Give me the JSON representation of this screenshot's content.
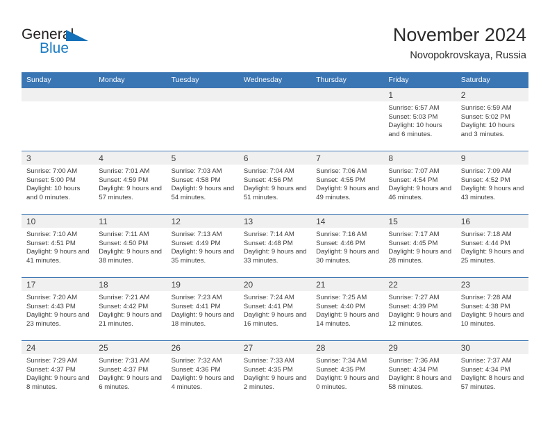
{
  "brand": {
    "name_top": "General",
    "name_bottom": "Blue",
    "triangle_color": "#1470b8",
    "text_color": "#231f20",
    "blue_color": "#1a7bc4"
  },
  "header": {
    "title": "November 2024",
    "subtitle": "Novopokrovskaya, Russia"
  },
  "theme": {
    "header_bg": "#3b76b4",
    "header_text": "#ffffff",
    "daynum_bg": "#f0f0f0",
    "row_separator": "#3b76b4",
    "body_text": "#3d3d3d"
  },
  "weekday_headers": [
    "Sunday",
    "Monday",
    "Tuesday",
    "Wednesday",
    "Thursday",
    "Friday",
    "Saturday"
  ],
  "labels": {
    "sunrise_prefix": "Sunrise:",
    "sunset_prefix": "Sunset:",
    "daylight_prefix": "Daylight:"
  },
  "weeks": [
    [
      {
        "day": "",
        "empty": true,
        "sunrise": "",
        "sunset": "",
        "daylight": ""
      },
      {
        "day": "",
        "empty": true,
        "sunrise": "",
        "sunset": "",
        "daylight": ""
      },
      {
        "day": "",
        "empty": true,
        "sunrise": "",
        "sunset": "",
        "daylight": ""
      },
      {
        "day": "",
        "empty": true,
        "sunrise": "",
        "sunset": "",
        "daylight": ""
      },
      {
        "day": "",
        "empty": true,
        "sunrise": "",
        "sunset": "",
        "daylight": ""
      },
      {
        "day": "1",
        "empty": false,
        "sunrise": "Sunrise: 6:57 AM",
        "sunset": "Sunset: 5:03 PM",
        "daylight": "Daylight: 10 hours and 6 minutes."
      },
      {
        "day": "2",
        "empty": false,
        "sunrise": "Sunrise: 6:59 AM",
        "sunset": "Sunset: 5:02 PM",
        "daylight": "Daylight: 10 hours and 3 minutes."
      }
    ],
    [
      {
        "day": "3",
        "empty": false,
        "sunrise": "Sunrise: 7:00 AM",
        "sunset": "Sunset: 5:00 PM",
        "daylight": "Daylight: 10 hours and 0 minutes."
      },
      {
        "day": "4",
        "empty": false,
        "sunrise": "Sunrise: 7:01 AM",
        "sunset": "Sunset: 4:59 PM",
        "daylight": "Daylight: 9 hours and 57 minutes."
      },
      {
        "day": "5",
        "empty": false,
        "sunrise": "Sunrise: 7:03 AM",
        "sunset": "Sunset: 4:58 PM",
        "daylight": "Daylight: 9 hours and 54 minutes."
      },
      {
        "day": "6",
        "empty": false,
        "sunrise": "Sunrise: 7:04 AM",
        "sunset": "Sunset: 4:56 PM",
        "daylight": "Daylight: 9 hours and 51 minutes."
      },
      {
        "day": "7",
        "empty": false,
        "sunrise": "Sunrise: 7:06 AM",
        "sunset": "Sunset: 4:55 PM",
        "daylight": "Daylight: 9 hours and 49 minutes."
      },
      {
        "day": "8",
        "empty": false,
        "sunrise": "Sunrise: 7:07 AM",
        "sunset": "Sunset: 4:54 PM",
        "daylight": "Daylight: 9 hours and 46 minutes."
      },
      {
        "day": "9",
        "empty": false,
        "sunrise": "Sunrise: 7:09 AM",
        "sunset": "Sunset: 4:52 PM",
        "daylight": "Daylight: 9 hours and 43 minutes."
      }
    ],
    [
      {
        "day": "10",
        "empty": false,
        "sunrise": "Sunrise: 7:10 AM",
        "sunset": "Sunset: 4:51 PM",
        "daylight": "Daylight: 9 hours and 41 minutes."
      },
      {
        "day": "11",
        "empty": false,
        "sunrise": "Sunrise: 7:11 AM",
        "sunset": "Sunset: 4:50 PM",
        "daylight": "Daylight: 9 hours and 38 minutes."
      },
      {
        "day": "12",
        "empty": false,
        "sunrise": "Sunrise: 7:13 AM",
        "sunset": "Sunset: 4:49 PM",
        "daylight": "Daylight: 9 hours and 35 minutes."
      },
      {
        "day": "13",
        "empty": false,
        "sunrise": "Sunrise: 7:14 AM",
        "sunset": "Sunset: 4:48 PM",
        "daylight": "Daylight: 9 hours and 33 minutes."
      },
      {
        "day": "14",
        "empty": false,
        "sunrise": "Sunrise: 7:16 AM",
        "sunset": "Sunset: 4:46 PM",
        "daylight": "Daylight: 9 hours and 30 minutes."
      },
      {
        "day": "15",
        "empty": false,
        "sunrise": "Sunrise: 7:17 AM",
        "sunset": "Sunset: 4:45 PM",
        "daylight": "Daylight: 9 hours and 28 minutes."
      },
      {
        "day": "16",
        "empty": false,
        "sunrise": "Sunrise: 7:18 AM",
        "sunset": "Sunset: 4:44 PM",
        "daylight": "Daylight: 9 hours and 25 minutes."
      }
    ],
    [
      {
        "day": "17",
        "empty": false,
        "sunrise": "Sunrise: 7:20 AM",
        "sunset": "Sunset: 4:43 PM",
        "daylight": "Daylight: 9 hours and 23 minutes."
      },
      {
        "day": "18",
        "empty": false,
        "sunrise": "Sunrise: 7:21 AM",
        "sunset": "Sunset: 4:42 PM",
        "daylight": "Daylight: 9 hours and 21 minutes."
      },
      {
        "day": "19",
        "empty": false,
        "sunrise": "Sunrise: 7:23 AM",
        "sunset": "Sunset: 4:41 PM",
        "daylight": "Daylight: 9 hours and 18 minutes."
      },
      {
        "day": "20",
        "empty": false,
        "sunrise": "Sunrise: 7:24 AM",
        "sunset": "Sunset: 4:41 PM",
        "daylight": "Daylight: 9 hours and 16 minutes."
      },
      {
        "day": "21",
        "empty": false,
        "sunrise": "Sunrise: 7:25 AM",
        "sunset": "Sunset: 4:40 PM",
        "daylight": "Daylight: 9 hours and 14 minutes."
      },
      {
        "day": "22",
        "empty": false,
        "sunrise": "Sunrise: 7:27 AM",
        "sunset": "Sunset: 4:39 PM",
        "daylight": "Daylight: 9 hours and 12 minutes."
      },
      {
        "day": "23",
        "empty": false,
        "sunrise": "Sunrise: 7:28 AM",
        "sunset": "Sunset: 4:38 PM",
        "daylight": "Daylight: 9 hours and 10 minutes."
      }
    ],
    [
      {
        "day": "24",
        "empty": false,
        "sunrise": "Sunrise: 7:29 AM",
        "sunset": "Sunset: 4:37 PM",
        "daylight": "Daylight: 9 hours and 8 minutes."
      },
      {
        "day": "25",
        "empty": false,
        "sunrise": "Sunrise: 7:31 AM",
        "sunset": "Sunset: 4:37 PM",
        "daylight": "Daylight: 9 hours and 6 minutes."
      },
      {
        "day": "26",
        "empty": false,
        "sunrise": "Sunrise: 7:32 AM",
        "sunset": "Sunset: 4:36 PM",
        "daylight": "Daylight: 9 hours and 4 minutes."
      },
      {
        "day": "27",
        "empty": false,
        "sunrise": "Sunrise: 7:33 AM",
        "sunset": "Sunset: 4:35 PM",
        "daylight": "Daylight: 9 hours and 2 minutes."
      },
      {
        "day": "28",
        "empty": false,
        "sunrise": "Sunrise: 7:34 AM",
        "sunset": "Sunset: 4:35 PM",
        "daylight": "Daylight: 9 hours and 0 minutes."
      },
      {
        "day": "29",
        "empty": false,
        "sunrise": "Sunrise: 7:36 AM",
        "sunset": "Sunset: 4:34 PM",
        "daylight": "Daylight: 8 hours and 58 minutes."
      },
      {
        "day": "30",
        "empty": false,
        "sunrise": "Sunrise: 7:37 AM",
        "sunset": "Sunset: 4:34 PM",
        "daylight": "Daylight: 8 hours and 57 minutes."
      }
    ]
  ]
}
